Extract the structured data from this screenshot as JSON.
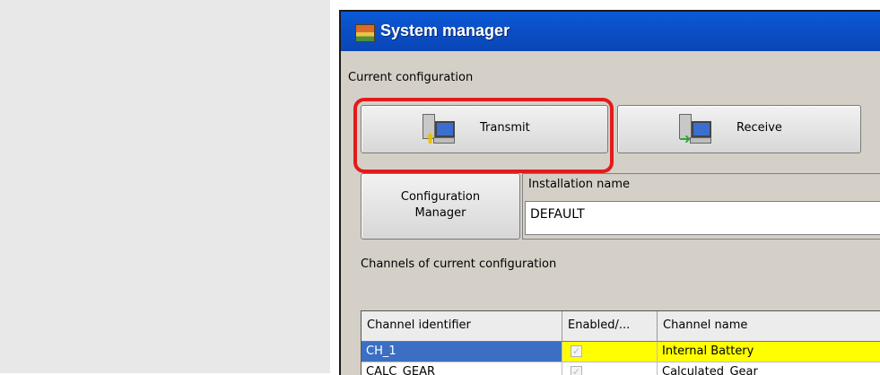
{
  "window": {
    "title": "System manager"
  },
  "current_configuration": {
    "label": "Current configuration",
    "transmit_label": "Transmit",
    "receive_label": "Receive"
  },
  "configuration_manager": {
    "line1": "Configuration",
    "line2": "Manager"
  },
  "installation": {
    "label": "Installation name",
    "value": "DEFAULT"
  },
  "channels": {
    "label": "Channels of current configuration",
    "columns": [
      "Channel identifier",
      "Enabled/...",
      "Channel name"
    ],
    "rows": [
      {
        "identifier": "CH_1",
        "enabled": true,
        "name": "Internal Battery"
      },
      {
        "identifier": "CALC_GEAR",
        "enabled": true,
        "name": "Calculated_Gear"
      }
    ]
  },
  "colors": {
    "selection": "#3b6fc4",
    "highlight_row": "#ffff00",
    "callout": "#e21b1b"
  }
}
